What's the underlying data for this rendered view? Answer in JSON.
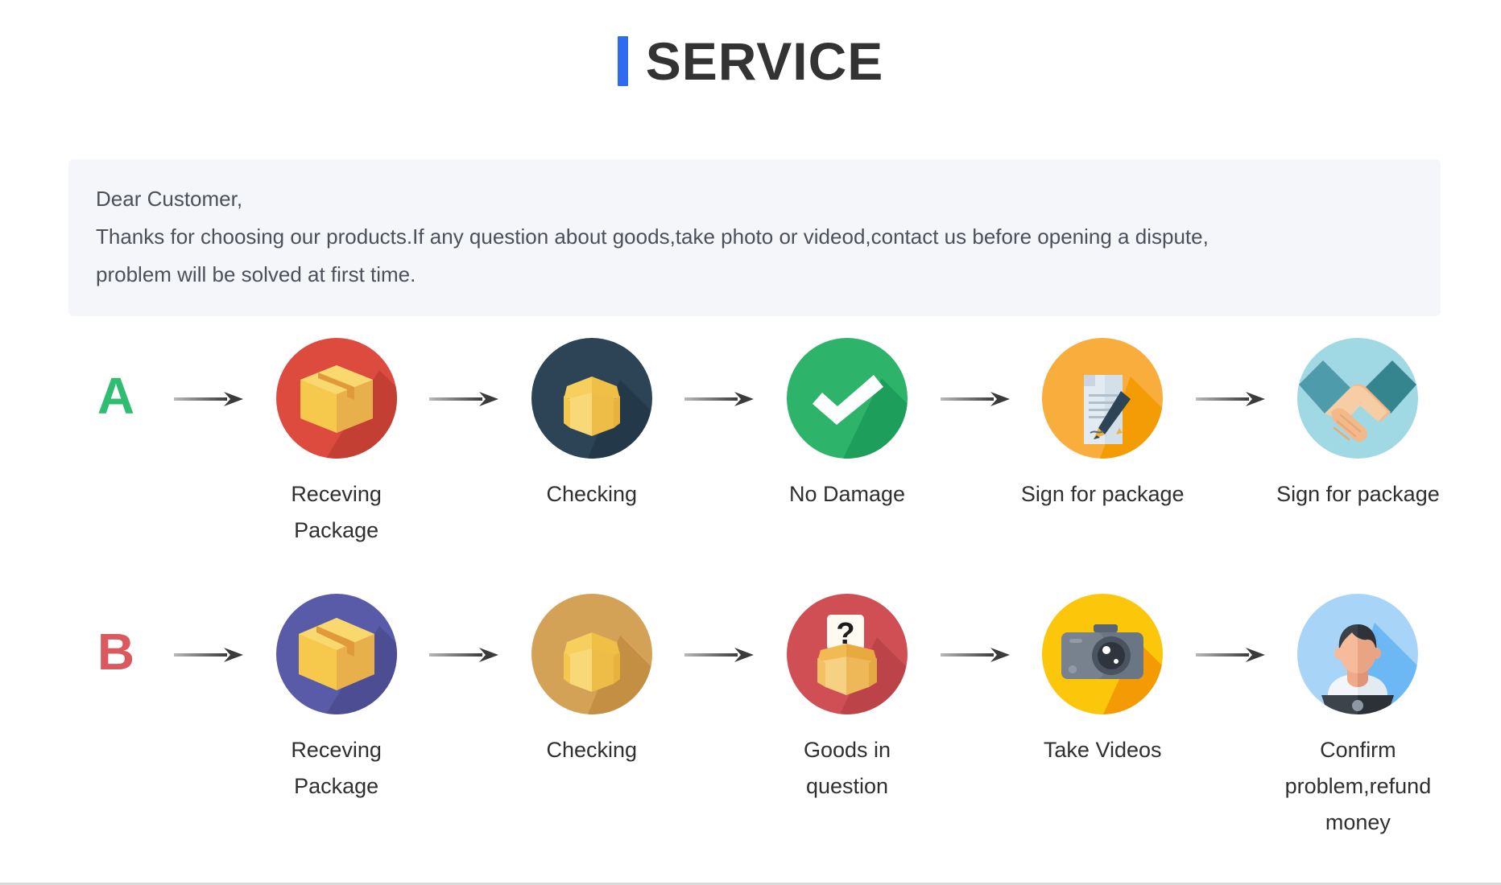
{
  "header": {
    "title": "SERVICE",
    "accent_color": "#2f6bf0"
  },
  "notice": {
    "line1": "Dear Customer,",
    "line2": "Thanks for choosing our products.If any question about goods,take photo or videod,contact us before opening a dispute,",
    "line3": "problem will be solved at first time.",
    "background_color": "#f5f6fa"
  },
  "flows": [
    {
      "badge": "A",
      "badge_color": "#2fbd72",
      "steps": [
        {
          "label": "Receving Package",
          "icon": "package-box-icon",
          "circle_color": "#dd4b3e"
        },
        {
          "label": "Checking",
          "icon": "open-box-icon",
          "circle_color": "#2c4456"
        },
        {
          "label": "No Damage",
          "icon": "checkmark-icon",
          "circle_color": "#2db36a"
        },
        {
          "label": "Sign for package",
          "icon": "document-pen-icon",
          "circle_color": "#f9ad3c"
        },
        {
          "label": "Sign for package",
          "icon": "handshake-icon",
          "circle_color": "#a0d8e3"
        }
      ]
    },
    {
      "badge": "B",
      "badge_color": "#d9595e",
      "steps": [
        {
          "label": "Receving Package",
          "icon": "package-box-icon",
          "circle_color": "#5a5ba8"
        },
        {
          "label": "Checking",
          "icon": "open-box-icon",
          "circle_color": "#d4a256"
        },
        {
          "label": "Goods in question",
          "icon": "question-box-icon",
          "circle_color": "#cf4f54"
        },
        {
          "label": "Take Videos",
          "icon": "camera-icon",
          "circle_color": "#fcc60a"
        },
        {
          "label": "Confirm  problem,refund money",
          "icon": "person-laptop-icon",
          "circle_color": "#a8d5f7"
        }
      ]
    }
  ]
}
